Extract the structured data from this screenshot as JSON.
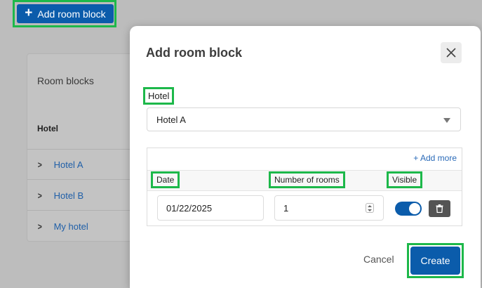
{
  "background": {
    "add_room_block_button": "Add room block",
    "card_title": "Room blocks",
    "column_header": "Hotel",
    "rows": [
      {
        "label": "Hotel A"
      },
      {
        "label": "Hotel B"
      },
      {
        "label": "My hotel"
      }
    ]
  },
  "modal": {
    "title": "Add room block",
    "hotel_label": "Hotel",
    "hotel_selected": "Hotel A",
    "add_more": "+ Add more",
    "columns": {
      "date": "Date",
      "rooms": "Number of rooms",
      "visible": "Visible"
    },
    "row": {
      "date": "01/22/2025",
      "rooms": "1",
      "visible": true
    },
    "cancel_label": "Cancel",
    "create_label": "Create"
  },
  "colors": {
    "primary": "#0b5cab",
    "highlight": "#1db84a",
    "link": "#2a6ab8"
  }
}
